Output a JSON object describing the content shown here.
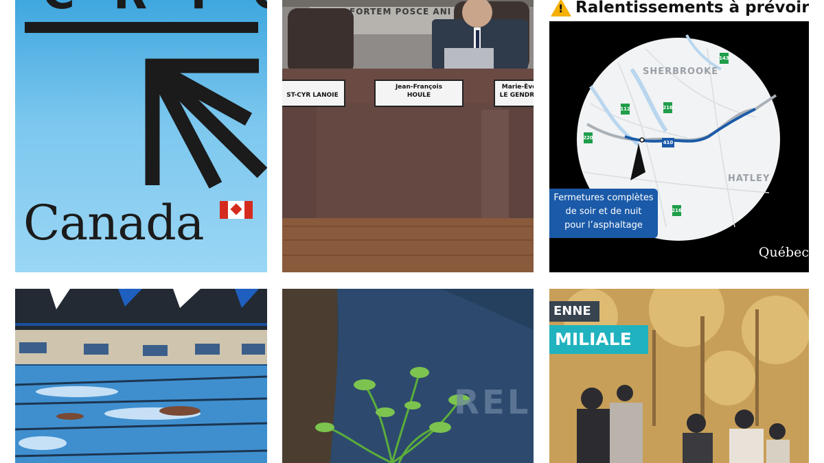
{
  "tiles": {
    "crtc": {
      "heading": "CRTC",
      "wordmark": "Canada"
    },
    "council": {
      "motto": "FORTEM POSCE ANI",
      "nameplates": [
        {
          "line1": "",
          "line2": "ST-CYR LANOIE"
        },
        {
          "line1": "Jean-François",
          "line2": "HOULE"
        },
        {
          "line1": "Marie-Ève",
          "line2": "LE GENDRE"
        }
      ]
    },
    "map": {
      "title": "Ralentissements à prévoir",
      "callout": [
        "Fermetures complètes",
        "de soir et de nuit",
        "pour l’asphaltage"
      ],
      "city_main": "SHERBROOKE",
      "city_secondary": "HATLEY",
      "brand": "Québec",
      "routes": [
        "143",
        "112",
        "216",
        "220",
        "410",
        "216"
      ]
    },
    "pool": {},
    "plant": {
      "shirt_text": "REL"
    },
    "family": {
      "tag_top": "ENNE",
      "tag_main": "MILIALE"
    }
  },
  "colors": {
    "crtc_bg": "#5fbbea",
    "map_callout": "#1a5aa8",
    "map_route": "#1a5aa8",
    "family_tag": "#20b3bf",
    "warning": "#f5b000"
  }
}
